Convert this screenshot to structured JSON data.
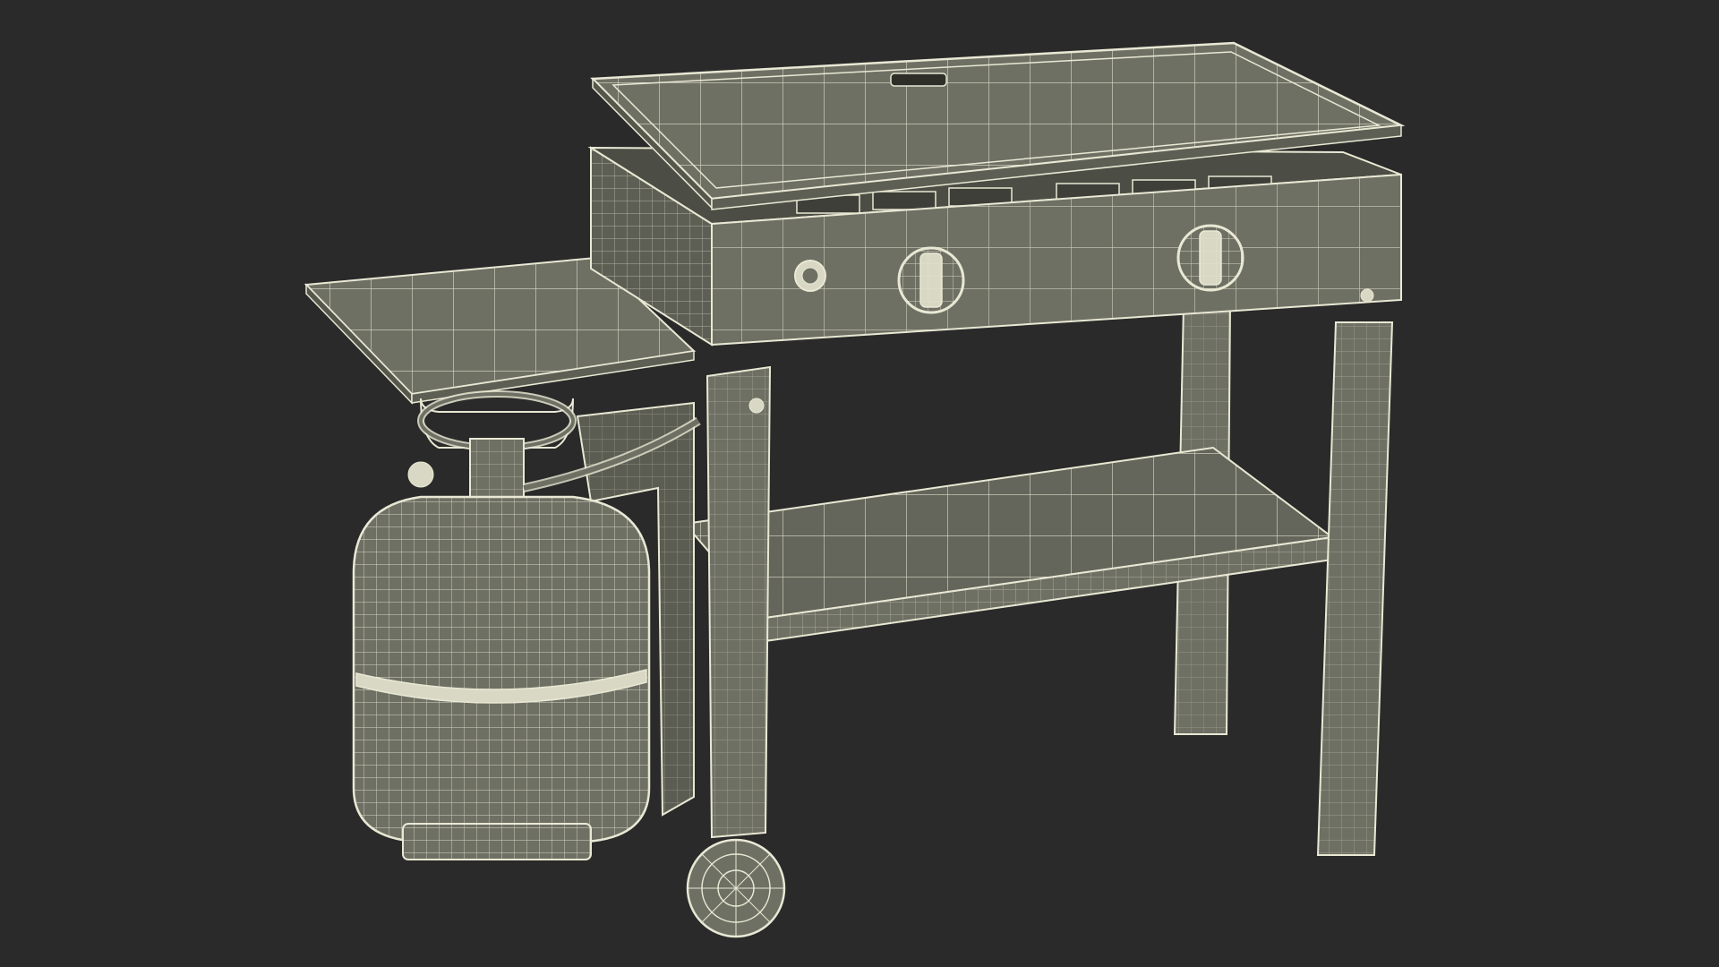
{
  "scene": {
    "background_color": "#2a2a2a",
    "surface_color": "#6f7064",
    "surface_dark_color": "#55564c",
    "wire_color": "#e8e8d4",
    "subject": "wireframe-render-of-flat-top-griddle-cart-with-propane-tank"
  }
}
